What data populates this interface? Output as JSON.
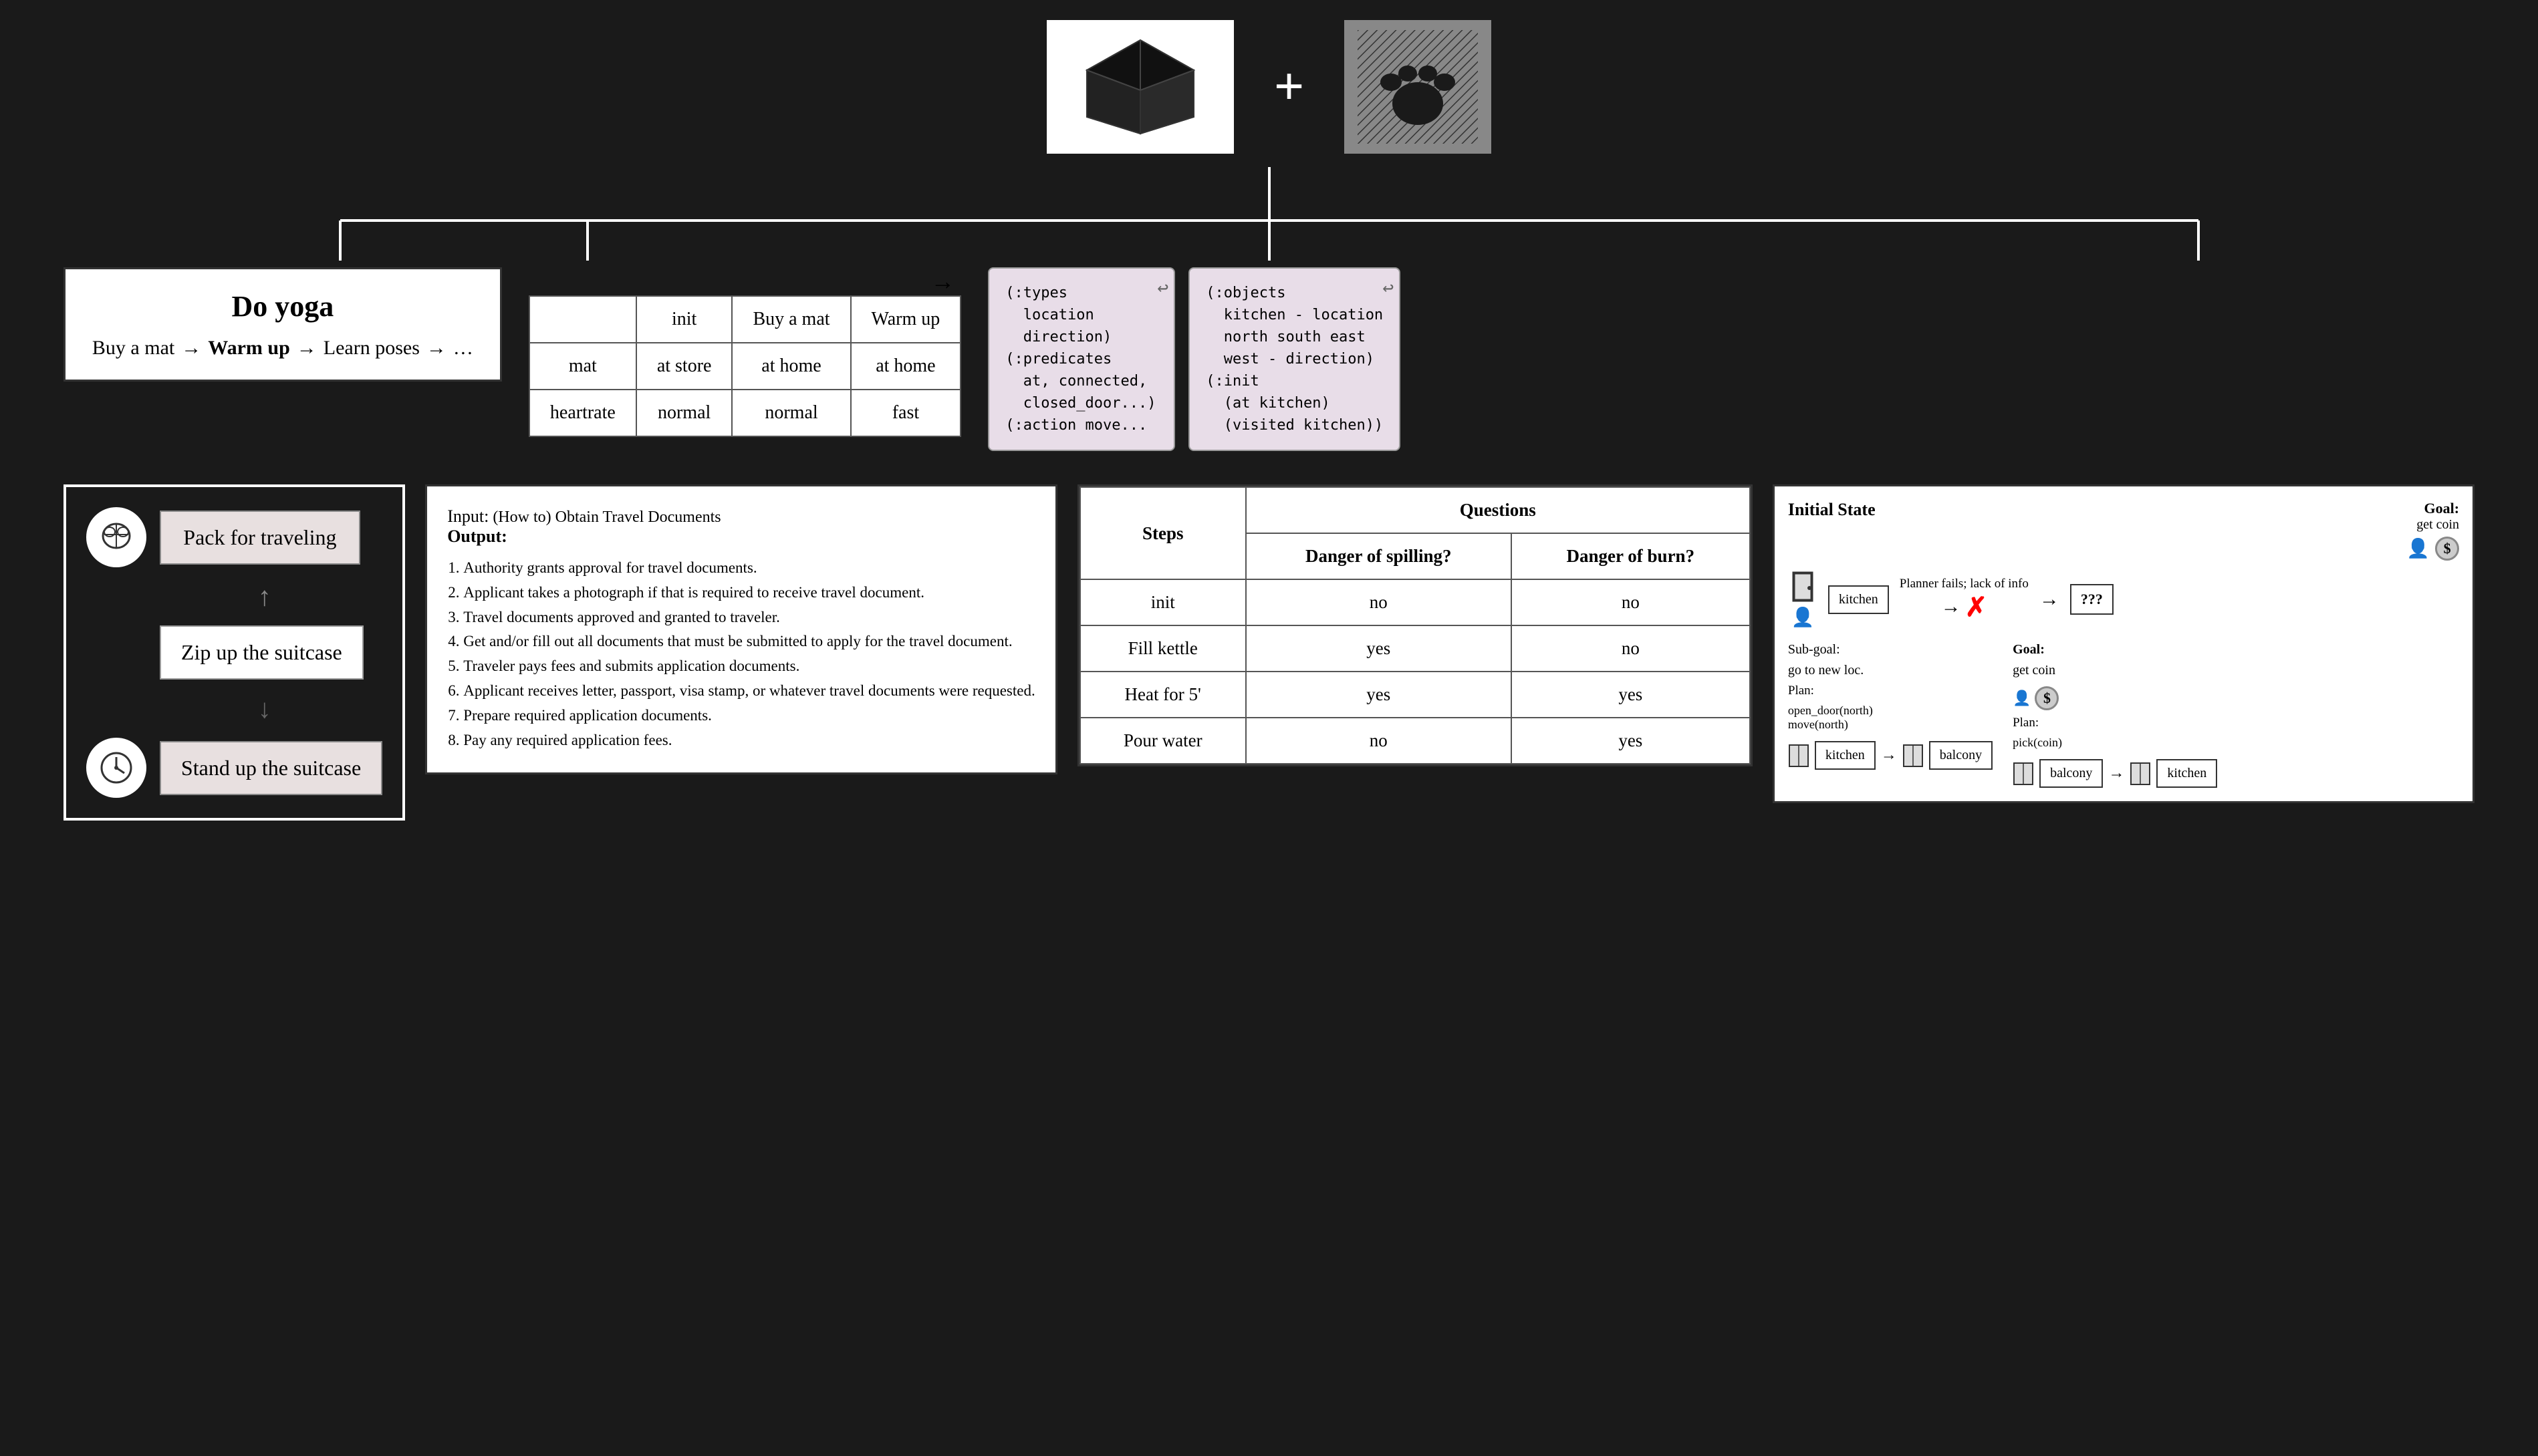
{
  "top": {
    "plus_sign": "+",
    "cube_alt": "black cube",
    "paw_alt": "paw print"
  },
  "yoga": {
    "title": "Do yoga",
    "step1": "Buy a mat",
    "arrow1": "→",
    "step2": "Warm up",
    "arrow2": "→",
    "step3": "Learn poses",
    "arrow3": "→",
    "ellipsis": "…"
  },
  "state_table": {
    "headers": [
      "",
      "init",
      "Buy a mat",
      "Warm up"
    ],
    "rows": [
      [
        "mat",
        "at store",
        "at home",
        "at home"
      ],
      [
        "heartrate",
        "normal",
        "normal",
        "fast"
      ]
    ]
  },
  "pddl1": {
    "content": "(:types\n  location\n  direction)\n(:predicates\n  at, connected,\n  closed_door...)\n(:action move..."
  },
  "pddl2": {
    "content": "(:objects\n  kitchen - location\n  north south east\n  west - direction)\n(:init\n  (at kitchen)\n  (visited kitchen))"
  },
  "suitcase": {
    "task1": "Pack for traveling",
    "task2": "Zip up the suitcase",
    "task3": "Stand up the suitcase"
  },
  "travel_docs": {
    "input_label": "Input:",
    "input_text": "(How to) Obtain Travel Documents",
    "output_label": "Output:",
    "steps": [
      "Authority grants approval for travel documents.",
      "Applicant takes a photograph if that is required to receive travel document.",
      "Travel documents approved and granted to traveler.",
      "Get and/or fill out all documents that must be submitted to apply for the travel document.",
      "Traveler pays fees and submits application documents.",
      "Applicant receives letter, passport, visa stamp, or whatever travel documents were requested.",
      "Prepare required application documents.",
      "Pay any required application fees."
    ]
  },
  "kettle_table": {
    "headers": [
      "Steps",
      "Questions",
      "",
      ""
    ],
    "sub_headers": [
      "",
      "Danger of spilling?",
      "Danger of burn?"
    ],
    "rows": [
      [
        "init",
        "no",
        "no"
      ],
      [
        "Fill kettle",
        "yes",
        "no"
      ],
      [
        "Heat for 5'",
        "yes",
        "yes"
      ],
      [
        "Pour water",
        "no",
        "yes"
      ]
    ]
  },
  "planner": {
    "title_left": "Initial State",
    "title_right": "Goal:",
    "goal_text": "get coin",
    "planner_fails": "Planner fails; lack of info",
    "question": "???",
    "subgoal_label": "Sub-goal:",
    "subgoal_text": "go to new loc.",
    "goal2_label": "Goal:",
    "goal2_text": "get coin",
    "plan1_label": "Plan:",
    "plan1_steps": "open_door(north)\nmove(north)",
    "plan2_label": "Plan:",
    "plan2_steps": "pick(coin)",
    "kitchen": "kitchen",
    "balcony": "balcony"
  }
}
